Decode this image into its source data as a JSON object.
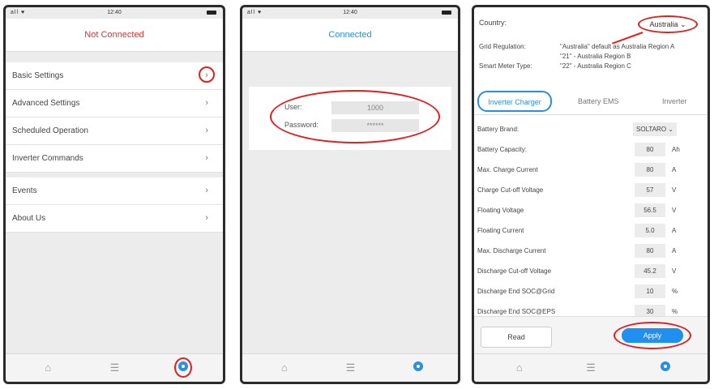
{
  "status": {
    "signal": "all ♥",
    "time": "12:40"
  },
  "screen1": {
    "title": "Not Connected",
    "menu": [
      {
        "label": "Basic Settings"
      },
      {
        "label": "Advanced Settings"
      },
      {
        "label": "Scheduled Operation"
      },
      {
        "label": "Inverter Commands"
      },
      {
        "label": "Events"
      },
      {
        "label": "About Us"
      }
    ],
    "chevron": "›"
  },
  "screen2": {
    "title": "Connected",
    "user_label": "User:",
    "user_value": "1000",
    "password_label": "Password:",
    "password_value": "******"
  },
  "screen3": {
    "country_label": "Country:",
    "country_value": "Australia ⌄",
    "grid_label": "Grid Regulation:",
    "grid_value_1": "\"Australia\" default as Australia Region A",
    "grid_value_2": "\"21\" - Australia Region B",
    "meter_label": "Smart Meter Type:",
    "meter_value": "\"22\" - Australia Region C",
    "tabs": [
      "Inverter Charger",
      "Battery EMS",
      "Inverter"
    ],
    "brand_label": "Battery Brand:",
    "brand_value": "SOLTARO ⌄",
    "params": [
      {
        "name": "Battery Capacity:",
        "value": "80",
        "unit": "Ah"
      },
      {
        "name": "Max. Charge Current",
        "value": "80",
        "unit": "A"
      },
      {
        "name": "Charge Cut-off Voltage",
        "value": "57",
        "unit": "V"
      },
      {
        "name": "Floating Voltage",
        "value": "56.5",
        "unit": "V"
      },
      {
        "name": "Floating Current",
        "value": "5.0",
        "unit": "A"
      },
      {
        "name": "Max. Discharge Current",
        "value": "80",
        "unit": "A"
      },
      {
        "name": "Discharge Cut-off Voltage",
        "value": "45.2",
        "unit": "V"
      },
      {
        "name": "Discharge End SOC@Grid",
        "value": "10",
        "unit": "%"
      },
      {
        "name": "Discharge End SOC@EPS",
        "value": "30",
        "unit": "%"
      }
    ],
    "read_label": "Read",
    "apply_label": "Apply"
  },
  "icons": {
    "home": "home-icon",
    "sliders": "sliders-icon",
    "gear": "gear-icon"
  },
  "colors": {
    "accent": "#2a8fe0",
    "highlight": "#e02020",
    "not_connected": "#e03030"
  }
}
